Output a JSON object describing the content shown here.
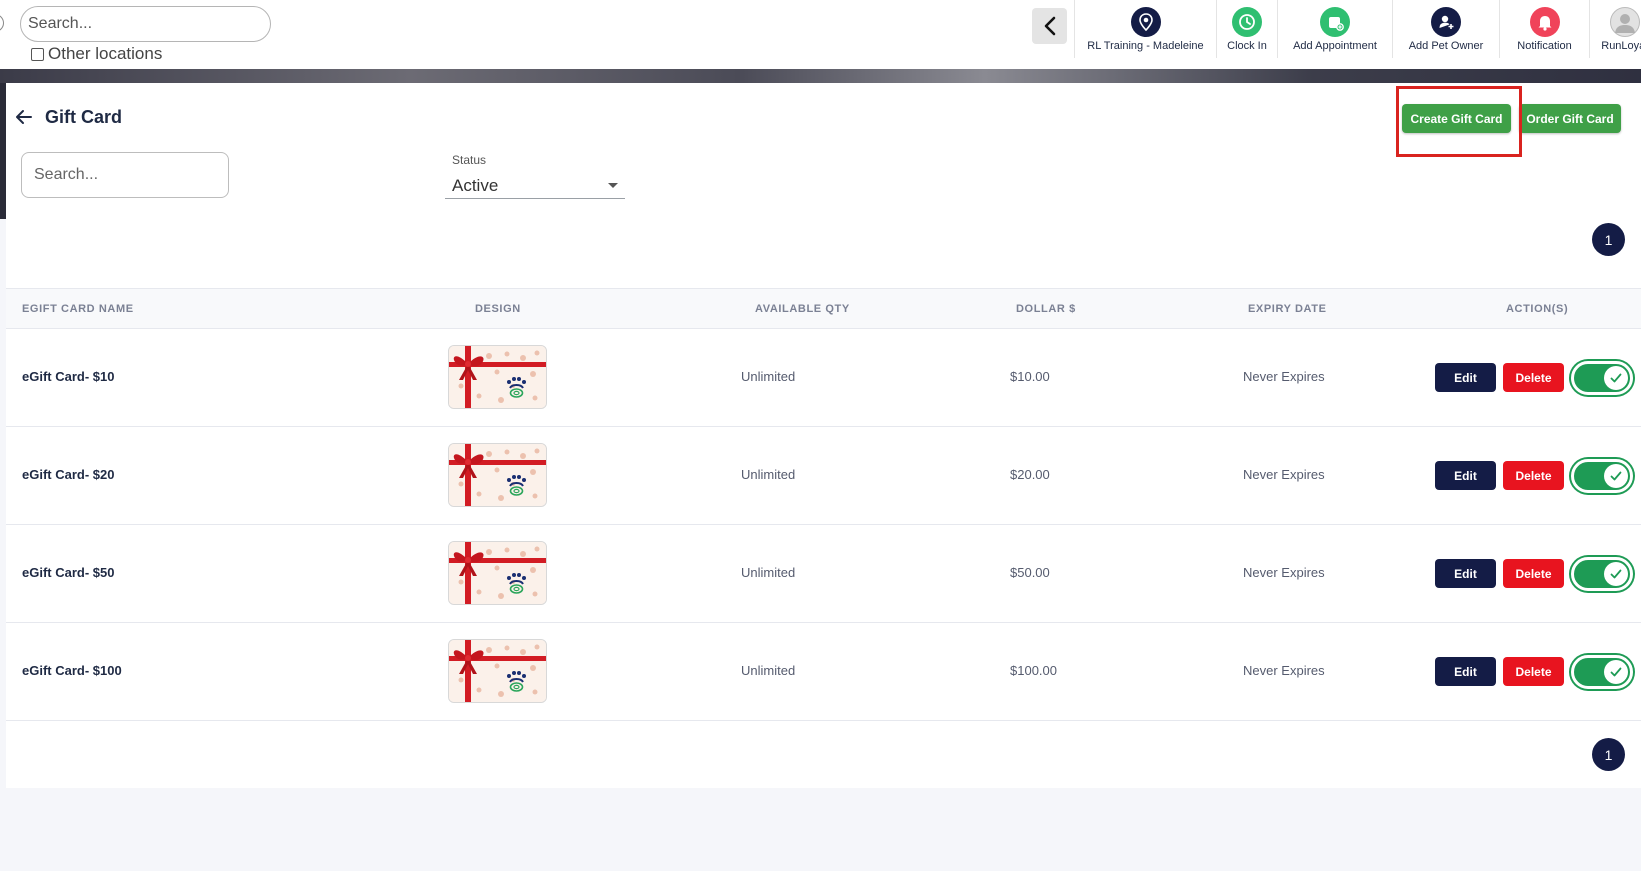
{
  "topbar": {
    "search_placeholder": "Search...",
    "other_locations_label": "Other locations",
    "nav_items": [
      {
        "label": "RL Training - Madeleine",
        "icon": "location-pin-icon",
        "color": "#141c46"
      },
      {
        "label": "Clock In",
        "icon": "clock-icon",
        "color": "#2fbf71"
      },
      {
        "label": "Add Appointment",
        "icon": "calendar-add-icon",
        "color": "#2fbf71"
      },
      {
        "label": "Add Pet Owner",
        "icon": "add-user-icon",
        "color": "#141c46"
      },
      {
        "label": "Notification",
        "icon": "bell-icon",
        "color": "#f0435a"
      },
      {
        "label": "RunLoyal",
        "icon": "avatar-icon",
        "color": "#cfcfcf"
      }
    ]
  },
  "page": {
    "title": "Gift Card",
    "create_button": "Create Gift Card",
    "order_button": "Order Gift Card",
    "search_placeholder": "Search...",
    "status_label": "Status",
    "status_value": "Active",
    "page_number_top": "1",
    "page_number_bottom": "1"
  },
  "table": {
    "headers": [
      "EGIFT CARD NAME",
      "DESIGN",
      "AVAILABLE QTY",
      "DOLLAR $",
      "EXPIRY DATE",
      "ACTION(S)"
    ],
    "rows": [
      {
        "name": "eGift Card- $10",
        "qty": "Unlimited",
        "dollar": "$10.00",
        "expiry": "Never Expires",
        "active": true
      },
      {
        "name": "eGift Card- $20",
        "qty": "Unlimited",
        "dollar": "$20.00",
        "expiry": "Never Expires",
        "active": true
      },
      {
        "name": "eGift Card- $50",
        "qty": "Unlimited",
        "dollar": "$50.00",
        "expiry": "Never Expires",
        "active": true
      },
      {
        "name": "eGift Card- $100",
        "qty": "Unlimited",
        "dollar": "$100.00",
        "expiry": "Never Expires",
        "active": true
      }
    ],
    "edit_label": "Edit",
    "delete_label": "Delete"
  },
  "colors": {
    "primary_green": "#3fa047",
    "navy": "#141c46",
    "danger": "#e8141f",
    "toggle_on": "#1e9b55",
    "highlight": "#d9231f"
  }
}
